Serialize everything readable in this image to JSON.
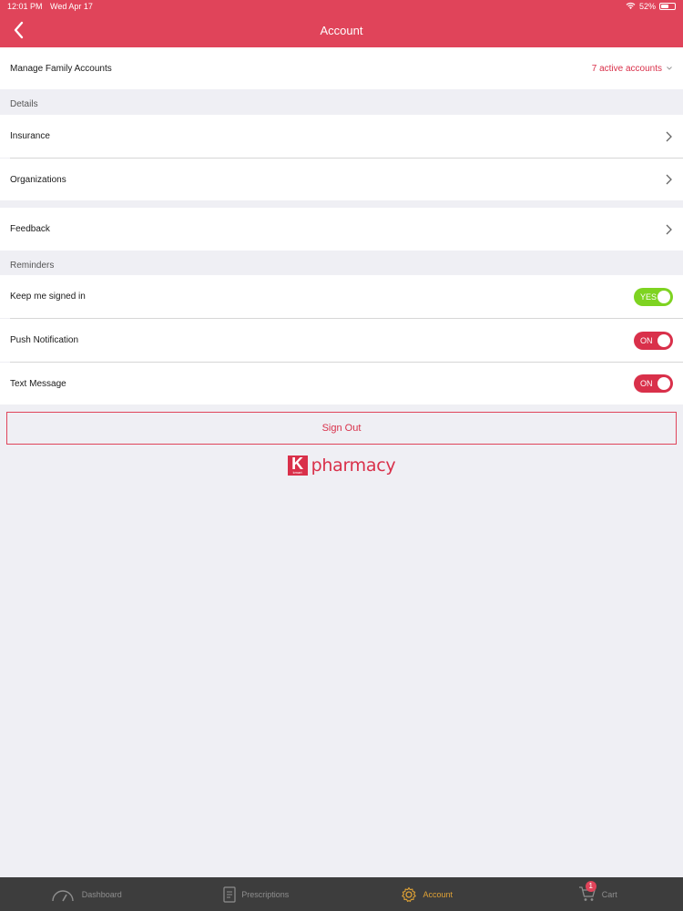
{
  "status_bar": {
    "time": "12:01 PM",
    "date": "Wed Apr 17",
    "battery": "52%"
  },
  "header": {
    "title": "Account"
  },
  "family": {
    "label": "Manage Family Accounts",
    "value": "7 active accounts"
  },
  "sections": {
    "details": "Details",
    "reminders": "Reminders"
  },
  "details_items": {
    "insurance": "Insurance",
    "organizations": "Organizations",
    "feedback": "Feedback"
  },
  "reminders": {
    "keep_signed_in": {
      "label": "Keep me signed in",
      "state": "YES"
    },
    "push": {
      "label": "Push Notification",
      "state": "ON"
    },
    "text": {
      "label": "Text Message",
      "state": "ON"
    }
  },
  "sign_out": "Sign Out",
  "logo": {
    "letter": "K",
    "sub": "kmart",
    "word": "pharmacy"
  },
  "tabs": {
    "dashboard": "Dashboard",
    "prescriptions": "Prescriptions",
    "account": "Account",
    "cart": "Cart",
    "cart_count": "1"
  },
  "colors": {
    "brand": "#e0445a",
    "toggle_yes": "#7ed321",
    "toggle_on": "#d9304a",
    "tab_active": "#e0a235"
  }
}
